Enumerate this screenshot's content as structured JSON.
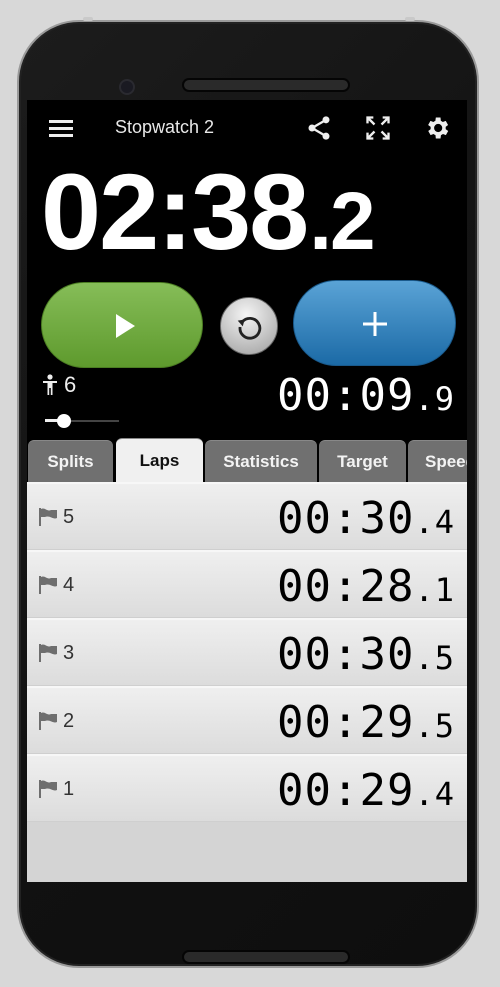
{
  "app": {
    "title": "Stopwatch 2"
  },
  "toolbar": {
    "menu_icon": "hamburger-menu-icon",
    "share_icon": "share-icon",
    "fullscreen_icon": "fullscreen-icon",
    "settings_icon": "gear-icon"
  },
  "timer": {
    "main": "02:38",
    "main_tenth": ".2",
    "lap": "00:09",
    "lap_tenth": ".9"
  },
  "controls": {
    "start_icon": "play-icon",
    "reset_icon": "reset-icon",
    "lap_icon": "plus-icon"
  },
  "runners": {
    "icon": "person-icon",
    "count": "6",
    "slider_fraction": 0.25
  },
  "tabs": [
    {
      "label": "Splits",
      "active": false
    },
    {
      "label": "Laps",
      "active": true
    },
    {
      "label": "Statistics",
      "active": false
    },
    {
      "label": "Target",
      "active": false
    },
    {
      "label": "Speed",
      "active": false
    }
  ],
  "laps": [
    {
      "number": "5",
      "time": "00:30",
      "tenth": ".4"
    },
    {
      "number": "4",
      "time": "00:28",
      "tenth": ".1"
    },
    {
      "number": "3",
      "time": "00:30",
      "tenth": ".5"
    },
    {
      "number": "2",
      "time": "00:29",
      "tenth": ".5"
    },
    {
      "number": "1",
      "time": "00:29",
      "tenth": ".4"
    }
  ],
  "colors": {
    "start_green": "#6fa83e",
    "lap_blue": "#2a7bbd",
    "active_tab": "#f0f0f0",
    "inactive_tab": "#707070"
  }
}
